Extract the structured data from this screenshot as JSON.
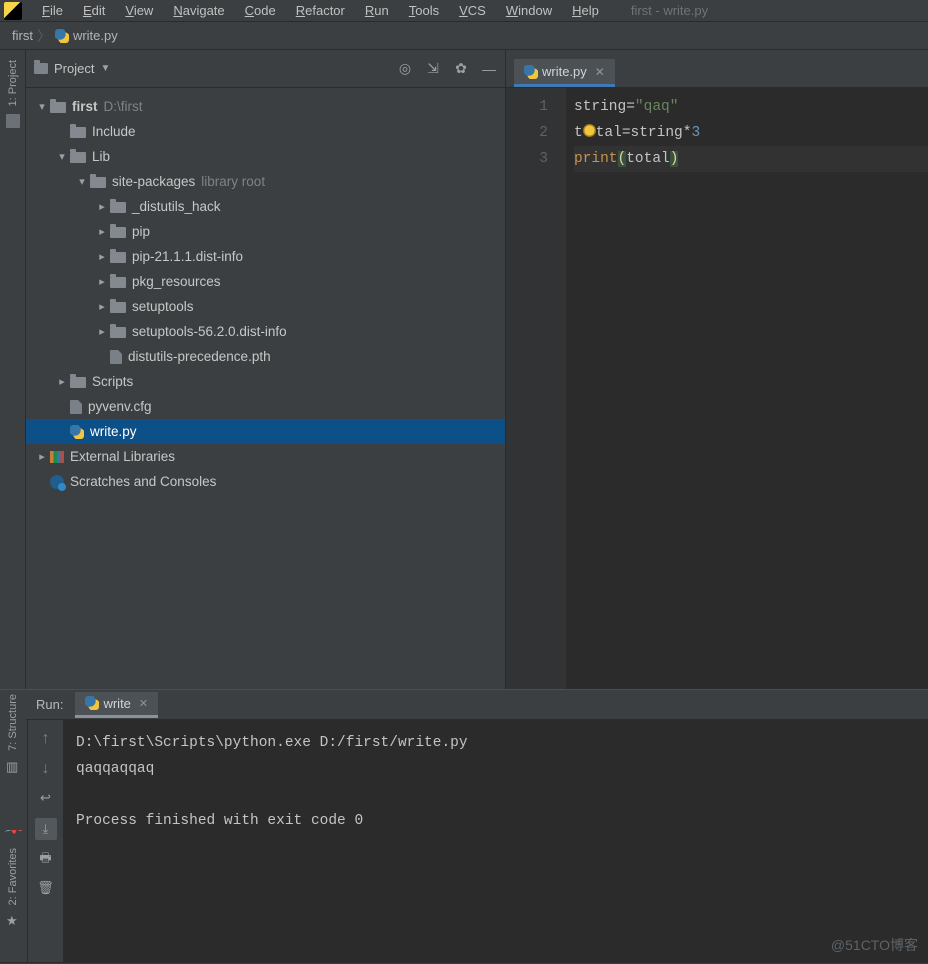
{
  "window_title": "first - write.py",
  "menu": [
    "File",
    "Edit",
    "View",
    "Navigate",
    "Code",
    "Refactor",
    "Run",
    "Tools",
    "VCS",
    "Window",
    "Help"
  ],
  "breadcrumb": {
    "project": "first",
    "file": "write.py"
  },
  "project_panel": {
    "title": "Project",
    "tree": [
      {
        "indent": 1,
        "chev": "down",
        "icon": "folder",
        "label": "first",
        "bold": true,
        "hint": "D:\\first"
      },
      {
        "indent": 2,
        "chev": "none",
        "icon": "folder",
        "label": "Include"
      },
      {
        "indent": 2,
        "chev": "down",
        "icon": "folder",
        "label": "Lib"
      },
      {
        "indent": 3,
        "chev": "down",
        "icon": "folder",
        "label": "site-packages",
        "hint": "library root"
      },
      {
        "indent": 4,
        "chev": "right",
        "icon": "folder",
        "label": "_distutils_hack"
      },
      {
        "indent": 4,
        "chev": "right",
        "icon": "folder",
        "label": "pip"
      },
      {
        "indent": 4,
        "chev": "right",
        "icon": "folder",
        "label": "pip-21.1.1.dist-info"
      },
      {
        "indent": 4,
        "chev": "right",
        "icon": "folder",
        "label": "pkg_resources"
      },
      {
        "indent": 4,
        "chev": "right",
        "icon": "folder",
        "label": "setuptools"
      },
      {
        "indent": 4,
        "chev": "right",
        "icon": "folder",
        "label": "setuptools-56.2.0.dist-info"
      },
      {
        "indent": 4,
        "chev": "none",
        "icon": "file",
        "label": "distutils-precedence.pth"
      },
      {
        "indent": 2,
        "chev": "right",
        "icon": "folder",
        "label": "Scripts"
      },
      {
        "indent": 2,
        "chev": "none",
        "icon": "file",
        "label": "pyvenv.cfg"
      },
      {
        "indent": 2,
        "chev": "none",
        "icon": "py",
        "label": "write.py",
        "selected": true
      },
      {
        "indent": 1,
        "chev": "right",
        "icon": "lib",
        "label": "External Libraries"
      },
      {
        "indent": 1,
        "chev": "none",
        "icon": "scratch",
        "label": "Scratches and Consoles"
      }
    ]
  },
  "editor": {
    "tab_label": "write.py",
    "line_numbers": [
      "1",
      "2",
      "3"
    ],
    "lines": [
      {
        "tokens": [
          {
            "t": "string",
            "c": "id"
          },
          {
            "t": "=",
            "c": "op"
          },
          {
            "t": "\"qaq\"",
            "c": "str"
          }
        ]
      },
      {
        "tokens": [
          {
            "t": "t",
            "c": "id"
          },
          {
            "t": "BULB",
            "c": "bulb"
          },
          {
            "t": "tal",
            "c": "id"
          },
          {
            "t": "=",
            "c": "op"
          },
          {
            "t": "string",
            "c": "id"
          },
          {
            "t": "*",
            "c": "op"
          },
          {
            "t": "3",
            "c": "num"
          }
        ]
      },
      {
        "active": true,
        "tokens": [
          {
            "t": "print",
            "c": "kw"
          },
          {
            "t": "(",
            "c": "paren"
          },
          {
            "t": "total",
            "c": "id"
          },
          {
            "t": ")",
            "c": "paren"
          }
        ]
      }
    ]
  },
  "run": {
    "label": "Run:",
    "tab": "write",
    "output": "D:\\first\\Scripts\\python.exe D:/first/write.py\nqaqqaqqaq\n\nProcess finished with exit code 0"
  },
  "left_tabs": {
    "project": "1: Project",
    "structure": "7: Structure",
    "favorites": "2: Favorites"
  },
  "watermark": "@51CTO博客"
}
